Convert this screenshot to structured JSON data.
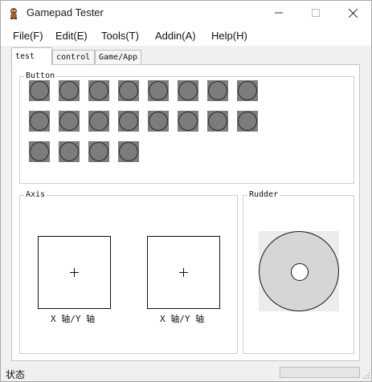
{
  "window": {
    "title": "Gamepad Tester",
    "icon": "gamepad-mascot-icon",
    "controls": [
      "minimize-icon",
      "maximize-icon",
      "close-icon"
    ]
  },
  "menu": {
    "items": [
      {
        "label": "File(F)"
      },
      {
        "label": "Edit(E)"
      },
      {
        "label": "Tools(T)"
      },
      {
        "label": "Addin(A)"
      },
      {
        "label": "Help(H)"
      }
    ]
  },
  "tabs": [
    {
      "label": "test",
      "active": true
    },
    {
      "label": "control",
      "active": false
    },
    {
      "label": "Game/App",
      "active": false
    }
  ],
  "button_group": {
    "label": "Button",
    "count": 20,
    "pressed": []
  },
  "axis_group": {
    "label": "Axis",
    "sticks": [
      {
        "label": "X 轴/Y 轴",
        "x": 0,
        "y": 0
      },
      {
        "label": "X 轴/Y 轴",
        "x": 0,
        "y": 0
      }
    ]
  },
  "rudder_group": {
    "label": "Rudder"
  },
  "status": {
    "text": "状态",
    "progress": 0
  },
  "colors": {
    "button_fill": "#7c7c7c",
    "rudder_fill": "#d6d6d6",
    "panel_border": "#cfcfcf"
  }
}
